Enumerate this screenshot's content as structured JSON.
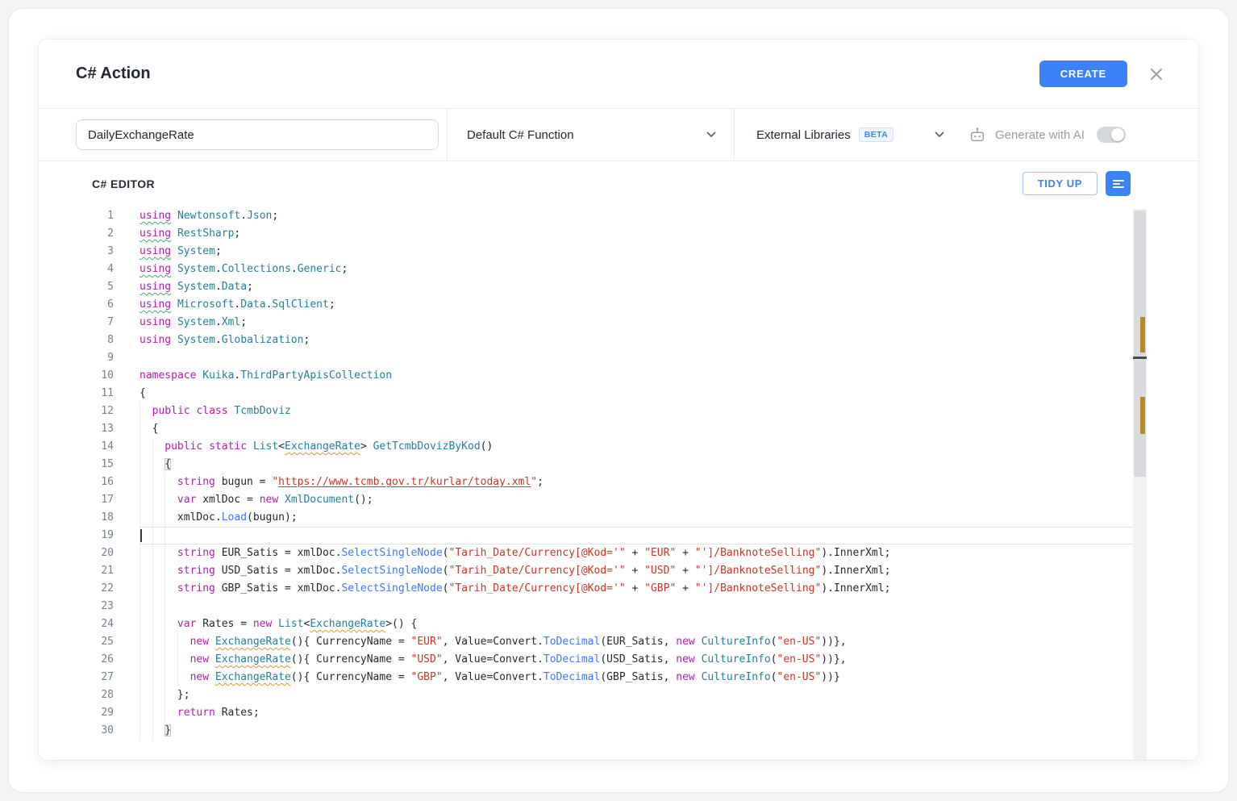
{
  "header": {
    "title": "C# Action",
    "create_label": "CREATE"
  },
  "toolbar": {
    "action_name": "DailyExchangeRate",
    "function_type": "Default C# Function",
    "libraries_label": "External Libraries",
    "beta_label": "BETA",
    "ai_label": "Generate with AI"
  },
  "editor": {
    "title": "C# EDITOR",
    "tidy_up_label": "TIDY UP",
    "lines": [
      {
        "n": 1,
        "i": 0,
        "t": [
          [
            "k g",
            "using"
          ],
          [
            "p",
            " "
          ],
          [
            "t",
            "Newtonsoft"
          ],
          [
            "p",
            "."
          ],
          [
            "t",
            "Json"
          ],
          [
            "p",
            ";"
          ]
        ]
      },
      {
        "n": 2,
        "i": 0,
        "t": [
          [
            "k g",
            "using"
          ],
          [
            "p",
            " "
          ],
          [
            "t",
            "RestSharp"
          ],
          [
            "p",
            ";"
          ]
        ]
      },
      {
        "n": 3,
        "i": 0,
        "t": [
          [
            "k g",
            "using"
          ],
          [
            "p",
            " "
          ],
          [
            "t",
            "System"
          ],
          [
            "p",
            ";"
          ]
        ]
      },
      {
        "n": 4,
        "i": 0,
        "t": [
          [
            "k g",
            "using"
          ],
          [
            "p",
            " "
          ],
          [
            "t",
            "System"
          ],
          [
            "p",
            "."
          ],
          [
            "t",
            "Collections"
          ],
          [
            "p",
            "."
          ],
          [
            "t",
            "Generic"
          ],
          [
            "p",
            ";"
          ]
        ]
      },
      {
        "n": 5,
        "i": 0,
        "t": [
          [
            "k g",
            "using"
          ],
          [
            "p",
            " "
          ],
          [
            "t",
            "System"
          ],
          [
            "p",
            "."
          ],
          [
            "t",
            "Data"
          ],
          [
            "p",
            ";"
          ]
        ]
      },
      {
        "n": 6,
        "i": 0,
        "t": [
          [
            "k g",
            "using"
          ],
          [
            "p",
            " "
          ],
          [
            "t",
            "Microsoft"
          ],
          [
            "p",
            "."
          ],
          [
            "t",
            "Data"
          ],
          [
            "p",
            "."
          ],
          [
            "t",
            "SqlClient"
          ],
          [
            "p",
            ";"
          ]
        ]
      },
      {
        "n": 7,
        "i": 0,
        "t": [
          [
            "k",
            "using"
          ],
          [
            "p",
            " "
          ],
          [
            "t",
            "System"
          ],
          [
            "p",
            "."
          ],
          [
            "t",
            "Xml"
          ],
          [
            "p",
            ";"
          ]
        ]
      },
      {
        "n": 8,
        "i": 0,
        "t": [
          [
            "k",
            "using"
          ],
          [
            "p",
            " "
          ],
          [
            "t",
            "System"
          ],
          [
            "p",
            "."
          ],
          [
            "t",
            "Globalization"
          ],
          [
            "p",
            ";"
          ]
        ]
      },
      {
        "n": 9,
        "i": 0,
        "t": []
      },
      {
        "n": 10,
        "i": 0,
        "t": [
          [
            "k",
            "namespace"
          ],
          [
            "p",
            " "
          ],
          [
            "t",
            "Kuika"
          ],
          [
            "p",
            "."
          ],
          [
            "t",
            "ThirdPartyApisCollection"
          ]
        ]
      },
      {
        "n": 11,
        "i": 0,
        "t": [
          [
            "p",
            "{"
          ]
        ]
      },
      {
        "n": 12,
        "i": 1,
        "t": [
          [
            "k",
            "public"
          ],
          [
            "p",
            " "
          ],
          [
            "k",
            "class"
          ],
          [
            "p",
            " "
          ],
          [
            "t",
            "TcmbDoviz"
          ]
        ]
      },
      {
        "n": 13,
        "i": 1,
        "t": [
          [
            "p",
            "{"
          ]
        ]
      },
      {
        "n": 14,
        "i": 2,
        "t": [
          [
            "k",
            "public"
          ],
          [
            "p",
            " "
          ],
          [
            "k",
            "static"
          ],
          [
            "p",
            " "
          ],
          [
            "t",
            "List"
          ],
          [
            "p",
            "<"
          ],
          [
            "t w",
            "ExchangeRate"
          ],
          [
            "p",
            "> "
          ],
          [
            "t",
            "GetTcmbDovizByKod"
          ],
          [
            "p",
            "()"
          ]
        ]
      },
      {
        "n": 15,
        "i": 2,
        "t": [
          [
            "p bm",
            "{"
          ]
        ]
      },
      {
        "n": 16,
        "i": 3,
        "t": [
          [
            "k",
            "string"
          ],
          [
            "p",
            " bugun = "
          ],
          [
            "s",
            "\""
          ],
          [
            "s u",
            "https://www.tcmb.gov.tr/kurlar/today.xml"
          ],
          [
            "s",
            "\""
          ],
          [
            "p",
            ";"
          ]
        ]
      },
      {
        "n": 17,
        "i": 3,
        "t": [
          [
            "k",
            "var"
          ],
          [
            "p",
            " xmlDoc = "
          ],
          [
            "k",
            "new"
          ],
          [
            "p",
            " "
          ],
          [
            "t",
            "XmlDocument"
          ],
          [
            "p",
            "();"
          ]
        ]
      },
      {
        "n": 18,
        "i": 3,
        "t": [
          [
            "p",
            "xmlDoc."
          ],
          [
            "m",
            "Load"
          ],
          [
            "p",
            "(bugun);"
          ]
        ]
      },
      {
        "n": 19,
        "i": 3,
        "a": 1,
        "t": []
      },
      {
        "n": 20,
        "i": 3,
        "t": [
          [
            "k",
            "string"
          ],
          [
            "p",
            " EUR_Satis = xmlDoc."
          ],
          [
            "m",
            "SelectSingleNode"
          ],
          [
            "p",
            "("
          ],
          [
            "s",
            "\"Tarih_Date/Currency[@Kod='\""
          ],
          [
            "p",
            " + "
          ],
          [
            "s",
            "\"EUR\""
          ],
          [
            "p",
            " + "
          ],
          [
            "s",
            "\"']/BanknoteSelling\""
          ],
          [
            "p",
            ").InnerXml;"
          ]
        ]
      },
      {
        "n": 21,
        "i": 3,
        "t": [
          [
            "k",
            "string"
          ],
          [
            "p",
            " USD_Satis = xmlDoc."
          ],
          [
            "m",
            "SelectSingleNode"
          ],
          [
            "p",
            "("
          ],
          [
            "s",
            "\"Tarih_Date/Currency[@Kod='\""
          ],
          [
            "p",
            " + "
          ],
          [
            "s",
            "\"USD\""
          ],
          [
            "p",
            " + "
          ],
          [
            "s",
            "\"']/BanknoteSelling\""
          ],
          [
            "p",
            ").InnerXml;"
          ]
        ]
      },
      {
        "n": 22,
        "i": 3,
        "t": [
          [
            "k",
            "string"
          ],
          [
            "p",
            " GBP_Satis = xmlDoc."
          ],
          [
            "m",
            "SelectSingleNode"
          ],
          [
            "p",
            "("
          ],
          [
            "s",
            "\"Tarih_Date/Currency[@Kod='\""
          ],
          [
            "p",
            " + "
          ],
          [
            "s",
            "\"GBP\""
          ],
          [
            "p",
            " + "
          ],
          [
            "s",
            "\"']/BanknoteSelling\""
          ],
          [
            "p",
            ").InnerXml;"
          ]
        ]
      },
      {
        "n": 23,
        "i": 3,
        "t": []
      },
      {
        "n": 24,
        "i": 3,
        "t": [
          [
            "k",
            "var"
          ],
          [
            "p",
            " Rates = "
          ],
          [
            "k",
            "new"
          ],
          [
            "p",
            " "
          ],
          [
            "t",
            "List"
          ],
          [
            "p",
            "<"
          ],
          [
            "t w",
            "ExchangeRate"
          ],
          [
            "p",
            ">() {"
          ]
        ]
      },
      {
        "n": 25,
        "i": 4,
        "t": [
          [
            "k",
            "new"
          ],
          [
            "p",
            " "
          ],
          [
            "t w",
            "ExchangeRate"
          ],
          [
            "p",
            "(){ CurrencyName = "
          ],
          [
            "s",
            "\"EUR\""
          ],
          [
            "p",
            ", Value=Convert."
          ],
          [
            "m",
            "ToDecimal"
          ],
          [
            "p",
            "(EUR_Satis, "
          ],
          [
            "k",
            "new"
          ],
          [
            "p",
            " "
          ],
          [
            "t",
            "CultureInfo"
          ],
          [
            "p",
            "("
          ],
          [
            "s",
            "\"en-US\""
          ],
          [
            "p",
            "))},"
          ]
        ]
      },
      {
        "n": 26,
        "i": 4,
        "t": [
          [
            "k",
            "new"
          ],
          [
            "p",
            " "
          ],
          [
            "t w",
            "ExchangeRate"
          ],
          [
            "p",
            "(){ CurrencyName = "
          ],
          [
            "s",
            "\"USD\""
          ],
          [
            "p",
            ", Value=Convert."
          ],
          [
            "m",
            "ToDecimal"
          ],
          [
            "p",
            "(USD_Satis, "
          ],
          [
            "k",
            "new"
          ],
          [
            "p",
            " "
          ],
          [
            "t",
            "CultureInfo"
          ],
          [
            "p",
            "("
          ],
          [
            "s",
            "\"en-US\""
          ],
          [
            "p",
            "))},"
          ]
        ]
      },
      {
        "n": 27,
        "i": 4,
        "t": [
          [
            "k",
            "new"
          ],
          [
            "p",
            " "
          ],
          [
            "t w",
            "ExchangeRate"
          ],
          [
            "p",
            "(){ CurrencyName = "
          ],
          [
            "s",
            "\"GBP\""
          ],
          [
            "p",
            ", Value=Convert."
          ],
          [
            "m",
            "ToDecimal"
          ],
          [
            "p",
            "(GBP_Satis, "
          ],
          [
            "k",
            "new"
          ],
          [
            "p",
            " "
          ],
          [
            "t",
            "CultureInfo"
          ],
          [
            "p",
            "("
          ],
          [
            "s",
            "\"en-US\""
          ],
          [
            "p",
            "))}"
          ]
        ]
      },
      {
        "n": 28,
        "i": 3,
        "t": [
          [
            "p",
            "};"
          ]
        ]
      },
      {
        "n": 29,
        "i": 3,
        "t": [
          [
            "k",
            "return"
          ],
          [
            "p",
            " Rates;"
          ]
        ]
      },
      {
        "n": 30,
        "i": 2,
        "t": [
          [
            "p bm",
            "}"
          ]
        ]
      }
    ]
  },
  "colors": {
    "accent": "#3b82f6",
    "keyword": "#a626a4",
    "type": "#267f99",
    "method": "#4078f2",
    "string": "#c0392b",
    "text": "#24292f",
    "line_number": "#74808f",
    "warn_squiggle": "#d4a11e",
    "unused_squiggle": "#3fae7a"
  }
}
